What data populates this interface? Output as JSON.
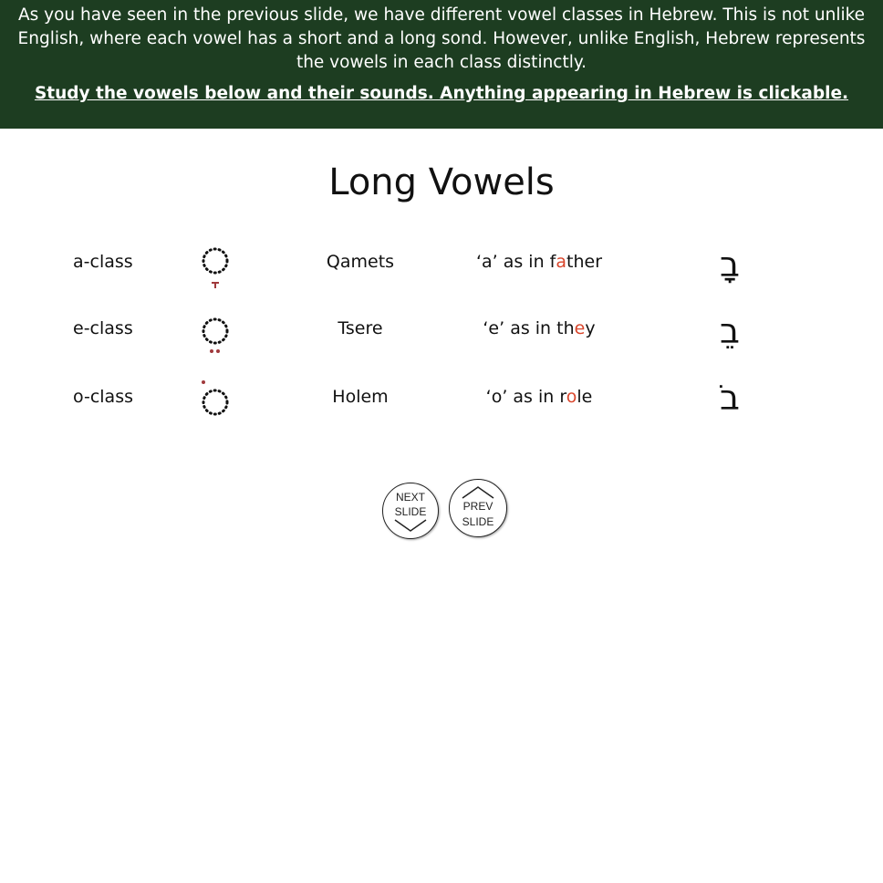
{
  "banner": {
    "intro": "As you have seen in the previous slide, we have different vowel classes in Hebrew.  This is not unlike English, where each vowel has a short and a long sond.  However, unlike English, Hebrew represents the vowels in each class distinctly.",
    "instruction": "Study the vowels below and their sounds.  Anything appearing in Hebrew is clickable."
  },
  "title": "Long Vowels",
  "colors": {
    "banner_bg": "#1d3d21",
    "highlight": "#d9452b",
    "vowel_mark": "#a0393c"
  },
  "vowels": [
    {
      "class": "a-class",
      "name": "Qamets",
      "sound_pre": "‘a’ as in f",
      "sound_hl": "a",
      "sound_post": "ther",
      "hebrew": "בָ"
    },
    {
      "class": "e-class",
      "name": "Tsere",
      "sound_pre": "‘e’ as in th",
      "sound_hl": "e",
      "sound_post": "y",
      "hebrew": "בֵ"
    },
    {
      "class": "o-class",
      "name": "Holem",
      "sound_pre": "‘o’ as in r",
      "sound_hl": "o",
      "sound_post": "le",
      "hebrew": "בֹ"
    }
  ],
  "nav": {
    "next_line1": "NEXT",
    "next_line2": "SLIDE",
    "prev_line1": "PREV",
    "prev_line2": "SLIDE"
  }
}
